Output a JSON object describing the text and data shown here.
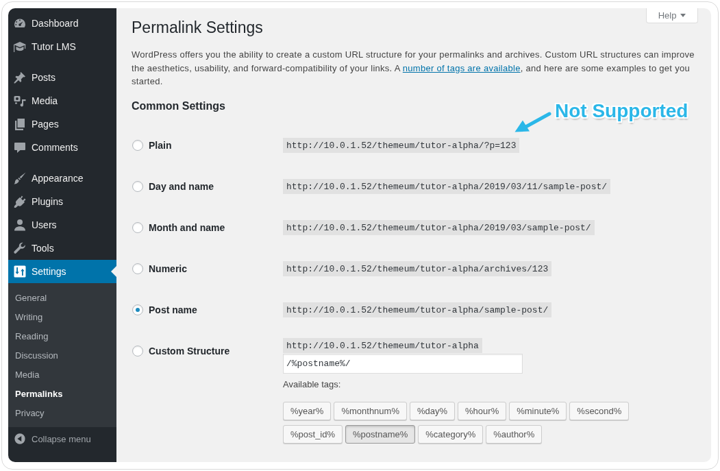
{
  "sidebar": {
    "menu_groups": [
      {
        "items": [
          {
            "label": "Dashboard",
            "selected": false
          },
          {
            "label": "Tutor LMS",
            "selected": false
          }
        ]
      },
      {
        "items": [
          {
            "label": "Posts",
            "selected": false
          },
          {
            "label": "Media",
            "selected": false
          },
          {
            "label": "Pages",
            "selected": false
          },
          {
            "label": "Comments",
            "selected": false
          }
        ]
      },
      {
        "items": [
          {
            "label": "Appearance",
            "selected": false
          },
          {
            "label": "Plugins",
            "selected": false
          },
          {
            "label": "Users",
            "selected": false
          },
          {
            "label": "Tools",
            "selected": false
          },
          {
            "label": "Settings",
            "selected": true,
            "submenu": [
              {
                "label": "General",
                "selected": false
              },
              {
                "label": "Writing",
                "selected": false
              },
              {
                "label": "Reading",
                "selected": false
              },
              {
                "label": "Discussion",
                "selected": false
              },
              {
                "label": "Media",
                "selected": false
              },
              {
                "label": "Permalinks",
                "selected": true
              },
              {
                "label": "Privacy",
                "selected": false
              }
            ]
          }
        ]
      }
    ],
    "collapse_label": "Collapse menu"
  },
  "help_button": "Help",
  "page_title": "Permalink Settings",
  "intro": {
    "text_before": "WordPress offers you the ability to create a custom URL structure for your permalinks and archives. Custom URL structures can improve the aesthetics, usability, and forward-compatibility of your links. A",
    "link": "number of tags are available",
    "text_after": ", and here are some examples to get you started."
  },
  "section_title": "Common Settings",
  "annotation": {
    "text": "Not Supported"
  },
  "options": [
    {
      "kind": "example",
      "label": "Plain",
      "selected": false,
      "example": "http://10.0.1.52/themeum/tutor-alpha/?p=123"
    },
    {
      "kind": "example",
      "label": "Day and name",
      "selected": false,
      "example": "http://10.0.1.52/themeum/tutor-alpha/2019/03/11/sample-post/"
    },
    {
      "kind": "example",
      "label": "Month and name",
      "selected": false,
      "example": "http://10.0.1.52/themeum/tutor-alpha/2019/03/sample-post/"
    },
    {
      "kind": "example",
      "label": "Numeric",
      "selected": false,
      "example": "http://10.0.1.52/themeum/tutor-alpha/archives/123"
    },
    {
      "kind": "example",
      "label": "Post name",
      "selected": true,
      "example": "http://10.0.1.52/themeum/tutor-alpha/sample-post/"
    },
    {
      "kind": "custom",
      "label": "Custom Structure",
      "selected": false,
      "prefix": "http://10.0.1.52/themeum/tutor-alpha",
      "value": "/%postname%/",
      "tags_label": "Available tags:",
      "tags": [
        {
          "label": "%year%",
          "selected": false
        },
        {
          "label": "%monthnum%",
          "selected": false
        },
        {
          "label": "%day%",
          "selected": false
        },
        {
          "label": "%hour%",
          "selected": false
        },
        {
          "label": "%minute%",
          "selected": false
        },
        {
          "label": "%second%",
          "selected": false
        },
        {
          "label": "%post_id%",
          "selected": false
        },
        {
          "label": "%postname%",
          "selected": true
        },
        {
          "label": "%category%",
          "selected": false
        },
        {
          "label": "%author%",
          "selected": false
        }
      ]
    }
  ]
}
